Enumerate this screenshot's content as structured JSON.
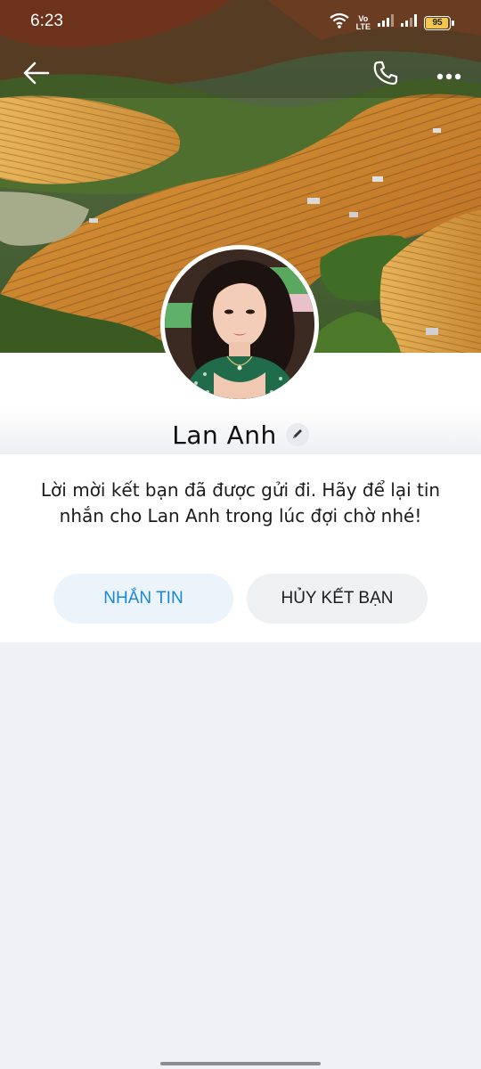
{
  "status_bar": {
    "time": "6:23",
    "volte_top": "Vo",
    "volte_bottom": "LTE",
    "battery_level": "95",
    "battery_fraction": 0.95
  },
  "header": {
    "back_icon": "arrow-left-icon",
    "call_icon": "phone-icon",
    "more_icon": "more-horizontal-icon"
  },
  "profile": {
    "name": "Lan Anh",
    "edit_icon": "pencil-icon",
    "message": "Lời mời kết bạn đã được gửi đi. Hãy để lại tin nhắn cho Lan Anh trong lúc đợi chờ nhé!"
  },
  "actions": {
    "message_label": "NHẮN TIN",
    "unfriend_label": "HỦY KẾT BẠN"
  },
  "colors": {
    "accent": "#1a87d8",
    "message_button_bg": "#ebf4fb",
    "unfriend_button_bg": "#eef0f2",
    "page_bg": "#eff1f4"
  }
}
